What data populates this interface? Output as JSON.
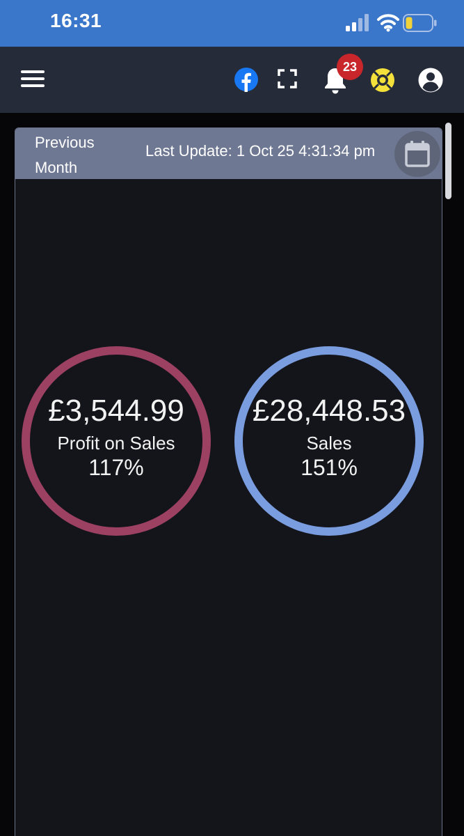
{
  "status_bar": {
    "time": "16:31",
    "icons": [
      "signal-icon",
      "wifi-icon",
      "battery-icon"
    ]
  },
  "app_bar": {
    "icons": [
      "menu-icon",
      "facebook-icon",
      "fullscreen-icon",
      "bell-icon",
      "help-icon",
      "account-icon"
    ],
    "notification_count": "23",
    "colors": {
      "status_bar": "#3a76c9",
      "app_bar": "#262b3a",
      "badge": "#c8262b",
      "help": "#f3e03a",
      "facebook": "#1877f2"
    }
  },
  "panel": {
    "period_label": "Previous Month",
    "last_update": "Last Update: 1 Oct 25 4:31:34 pm",
    "calendar_icon": "calendar-icon"
  },
  "metrics": [
    {
      "value": "£3,544.99",
      "label": "Profit on Sales",
      "percent": "117%",
      "ring_color": "#9d4163"
    },
    {
      "value": "£28,448.53",
      "label": "Sales",
      "percent": "151%",
      "ring_color": "#7a9ddf"
    }
  ]
}
